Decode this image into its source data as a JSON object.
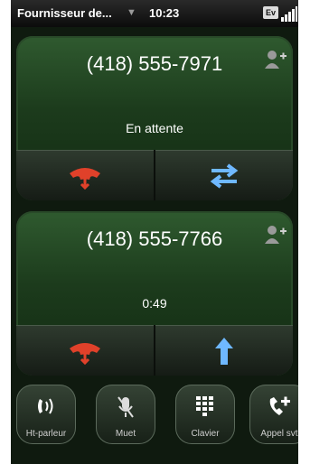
{
  "statusbar": {
    "carrier": "Fournisseur de...",
    "time": "10:23",
    "network_badge": "Ev"
  },
  "calls": [
    {
      "number": "(418) 555-7971",
      "status": "En attente",
      "primary_action_icon": "hang-up-icon",
      "secondary_action_icon": "swap-calls-icon"
    },
    {
      "number": "(418) 555-7766",
      "status": "0:49",
      "primary_action_icon": "hang-up-icon",
      "secondary_action_icon": "merge-calls-icon"
    }
  ],
  "dock": [
    {
      "label": "Ht-parleur",
      "icon": "speakerphone-icon"
    },
    {
      "label": "Muet",
      "icon": "mute-icon"
    },
    {
      "label": "Clavier",
      "icon": "keypad-icon"
    },
    {
      "label": "Appel svt",
      "icon": "add-call-icon"
    }
  ],
  "colors": {
    "hangup": "#e0412a",
    "action_blue": "#6fb8ff"
  }
}
